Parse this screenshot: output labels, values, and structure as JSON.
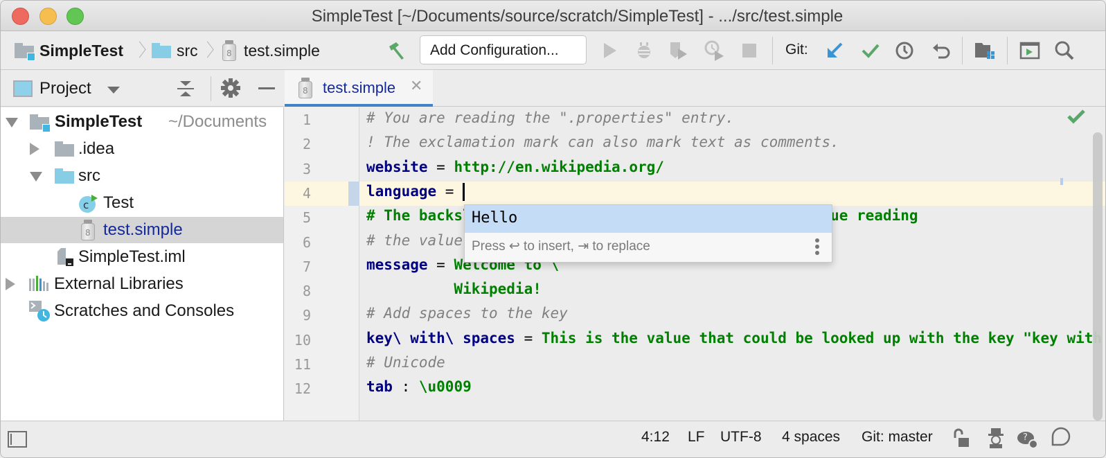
{
  "window": {
    "title": "SimpleTest [~/Documents/source/scratch/SimpleTest] - .../src/test.simple"
  },
  "navbar": {
    "breadcrumbs": [
      {
        "label": "SimpleTest",
        "icon": "project-folder-icon"
      },
      {
        "label": "src",
        "icon": "source-folder-icon"
      },
      {
        "label": "test.simple",
        "icon": "jar-file-icon"
      }
    ],
    "build_icon": "hammer-icon",
    "add_configuration_label": "Add Configuration...",
    "run_icons": [
      "run-icon",
      "debug-icon",
      "coverage-icon",
      "profile-icon",
      "stop-icon"
    ],
    "git_label": "Git:",
    "git_icons": [
      "update-project-icon",
      "commit-icon",
      "history-icon",
      "revert-icon"
    ],
    "extra_icons": [
      "project-structure-icon",
      "presentation-icon",
      "search-icon"
    ]
  },
  "project_panel": {
    "title": "Project",
    "tree": [
      {
        "label": "SimpleTest",
        "suffix": "~/Documents",
        "bold": true,
        "expanded": true,
        "depth": 0,
        "icon": "project-folder-icon"
      },
      {
        "label": ".idea",
        "expanded": false,
        "depth": 1,
        "icon": "folder-icon"
      },
      {
        "label": "src",
        "expanded": true,
        "depth": 1,
        "icon": "source-folder-icon"
      },
      {
        "label": "Test",
        "depth": 2,
        "icon": "class-icon"
      },
      {
        "label": "test.simple",
        "depth": 2,
        "icon": "jar-file-icon",
        "selected": true
      },
      {
        "label": "SimpleTest.iml",
        "depth": 1,
        "icon": "module-file-icon"
      },
      {
        "label": "External Libraries",
        "expanded": false,
        "depth": 0,
        "icon": "libraries-icon"
      },
      {
        "label": "Scratches and Consoles",
        "depth": 0,
        "icon": "scratches-icon"
      }
    ]
  },
  "editor": {
    "tab_label": "test.simple",
    "line_numbers": [
      "1",
      "2",
      "3",
      "4",
      "5",
      "6",
      "7",
      "8",
      "9",
      "10",
      "11",
      "12"
    ],
    "lines": [
      [
        {
          "t": "# You are reading the \".properties\" entry.",
          "c": "comment"
        }
      ],
      [
        {
          "t": "! The exclamation mark can also mark text as comments.",
          "c": "comment"
        }
      ],
      [
        {
          "t": "website",
          "c": "key"
        },
        {
          "t": " = ",
          "c": "eq"
        },
        {
          "t": "http://en.wikipedia.org/",
          "c": "val"
        }
      ],
      [
        {
          "t": "language",
          "c": "key"
        },
        {
          "t": " = ",
          "c": "eq"
        }
      ],
      [
        {
          "t": "# The backslash below tells the application to continue reading",
          "c": "val"
        }
      ],
      [
        {
          "t": "# the value onto the next line.",
          "c": "comment"
        }
      ],
      [
        {
          "t": "message",
          "c": "key"
        },
        {
          "t": " = ",
          "c": "eq"
        },
        {
          "t": "Welcome to \\",
          "c": "val"
        }
      ],
      [
        {
          "t": "          Wikipedia!",
          "c": "val"
        }
      ],
      [
        {
          "t": "# Add spaces to the key",
          "c": "comment"
        }
      ],
      [
        {
          "t": "key\\ with\\ spaces",
          "c": "key"
        },
        {
          "t": " = ",
          "c": "eq"
        },
        {
          "t": "This is the value that could be looked up with the key \"key with spaces\".",
          "c": "val"
        }
      ],
      [
        {
          "t": "# Unicode",
          "c": "comment"
        }
      ],
      [
        {
          "t": "tab",
          "c": "key"
        },
        {
          "t": " : ",
          "c": "eq"
        },
        {
          "t": "\\u0009",
          "c": "val"
        }
      ]
    ],
    "caret_line": 4,
    "completion": {
      "items": [
        "Hello"
      ],
      "hint": "Press ↩ to insert, ⇥ to replace"
    }
  },
  "statusbar": {
    "position": "4:12",
    "line_separator": "LF",
    "encoding": "UTF-8",
    "indent": "4 spaces",
    "vcs_branch": "Git: master"
  },
  "colors": {
    "accent": "#4083c9",
    "key": "#000080",
    "value": "#008000",
    "comment": "#808080",
    "current_line": "#fdf7e2",
    "completion_selected": "#c5dcf7"
  }
}
